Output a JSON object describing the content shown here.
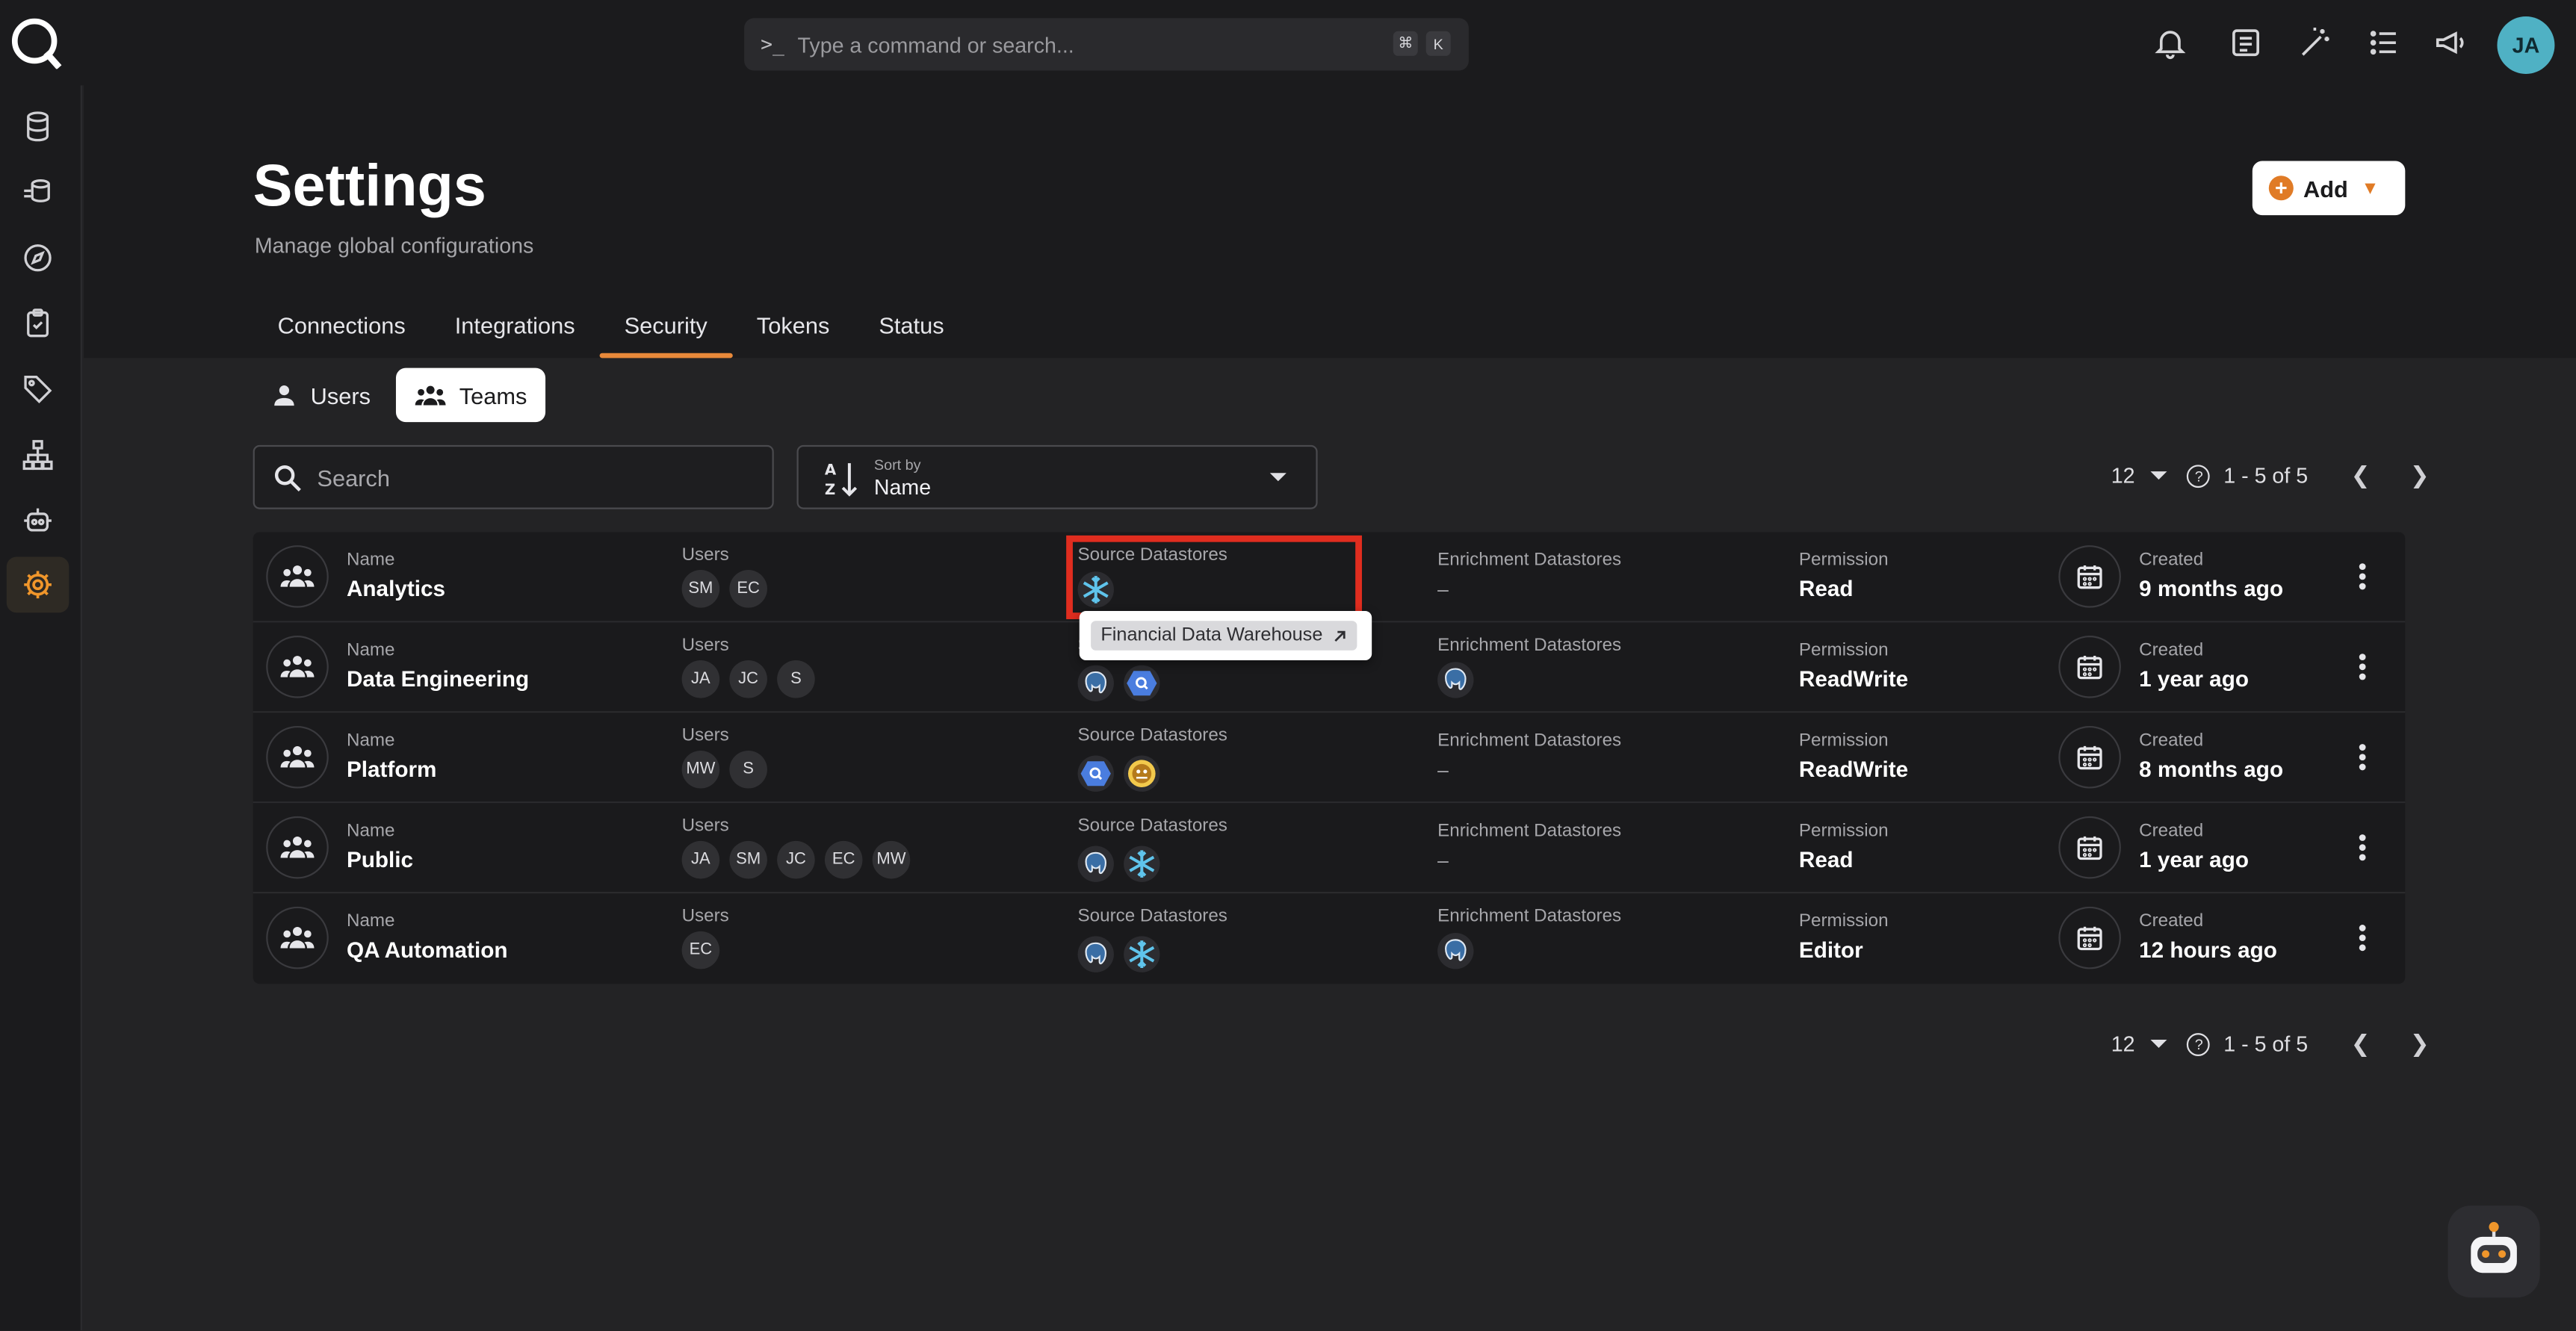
{
  "topbar": {
    "command_placeholder": "Type a command or search...",
    "shortcut_mod": "⌘",
    "shortcut_key": "K",
    "avatar_initials": "JA"
  },
  "page": {
    "title": "Settings",
    "subtitle": "Manage global configurations",
    "add_label": "Add"
  },
  "tabs": [
    "Connections",
    "Integrations",
    "Security",
    "Tokens",
    "Status"
  ],
  "active_tab": "Security",
  "subtabs": {
    "users": "Users",
    "teams": "Teams"
  },
  "search": {
    "placeholder": "Search"
  },
  "sort": {
    "label": "Sort by",
    "value": "Name"
  },
  "pagination": {
    "per_page": "12",
    "range": "1 - 5 of 5"
  },
  "columns": {
    "name": "Name",
    "users": "Users",
    "source": "Source Datastores",
    "enrichment": "Enrichment Datastores",
    "permission": "Permission",
    "created": "Created"
  },
  "teams": [
    {
      "name": "Analytics",
      "users": [
        "SM",
        "EC"
      ],
      "source": [
        "snowflake"
      ],
      "enrichment": [],
      "enrichment_text": "–",
      "permission": "Read",
      "created": "9 months ago"
    },
    {
      "name": "Data Engineering",
      "users": [
        "JA",
        "JC",
        "S"
      ],
      "source": [
        "postgres",
        "bigquery"
      ],
      "enrichment": [
        "postgres"
      ],
      "permission": "ReadWrite",
      "created": "1 year ago"
    },
    {
      "name": "Platform",
      "users": [
        "MW",
        "S"
      ],
      "source": [
        "bigquery",
        "hive"
      ],
      "enrichment": [],
      "enrichment_text": "–",
      "permission": "ReadWrite",
      "created": "8 months ago"
    },
    {
      "name": "Public",
      "users": [
        "JA",
        "SM",
        "JC",
        "EC",
        "MW"
      ],
      "source": [
        "postgres",
        "snowflake"
      ],
      "enrichment": [],
      "enrichment_text": "–",
      "permission": "Read",
      "created": "1 year ago"
    },
    {
      "name": "QA Automation",
      "users": [
        "EC"
      ],
      "source": [
        "postgres",
        "snowflake"
      ],
      "enrichment": [
        "postgres"
      ],
      "permission": "Editor",
      "created": "12 hours ago"
    }
  ],
  "tooltip": {
    "text": "Financial Data Warehouse",
    "icon": "external-link-icon"
  },
  "colors": {
    "accent": "#e8893a",
    "highlight": "#e02d1f",
    "avatar": "#4fb1c4"
  }
}
